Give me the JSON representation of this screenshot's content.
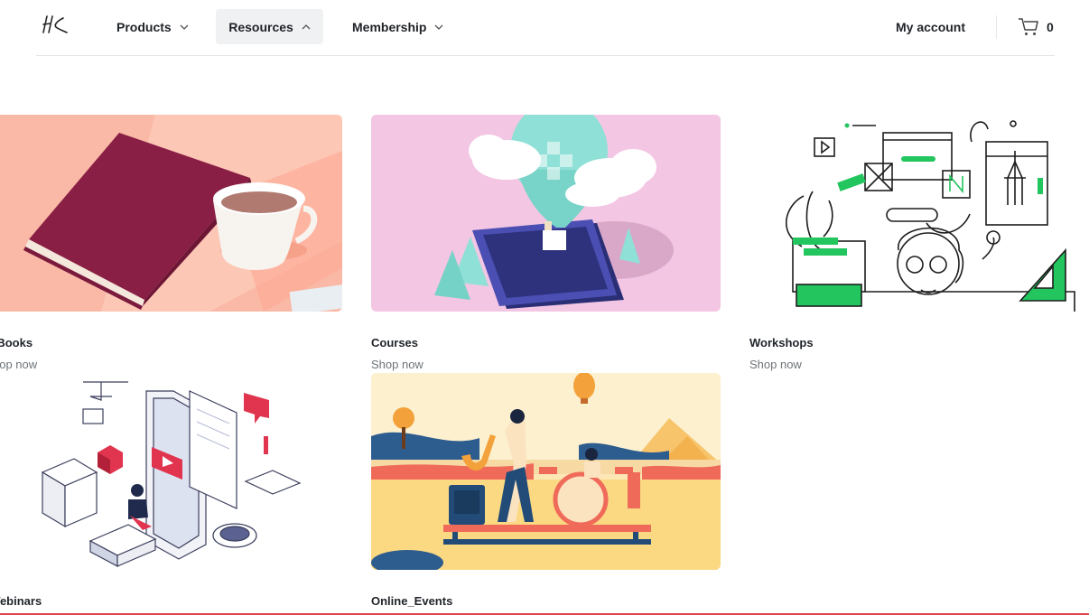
{
  "header": {
    "nav": [
      {
        "label": "Products"
      },
      {
        "label": "Resources"
      },
      {
        "label": "Membership"
      }
    ],
    "account_label": "My account",
    "cart_count": "0"
  },
  "cards": [
    {
      "title": "-Books",
      "shop": "hop now"
    },
    {
      "title": "Courses",
      "shop": "Shop now"
    },
    {
      "title": "Workshops",
      "shop": "Shop now"
    },
    {
      "title": "Vebinars"
    },
    {
      "title": "Online_Events"
    }
  ],
  "colors": {
    "accent_line": "#e0434d",
    "active_nav_bg": "#f0f1f2",
    "ebook_bg": "#f9b9a6",
    "course_bg": "#f3c6e3",
    "event_bg": "#fbd983",
    "workshop_green": "#22c55e",
    "webinar_red": "#e0344f"
  }
}
